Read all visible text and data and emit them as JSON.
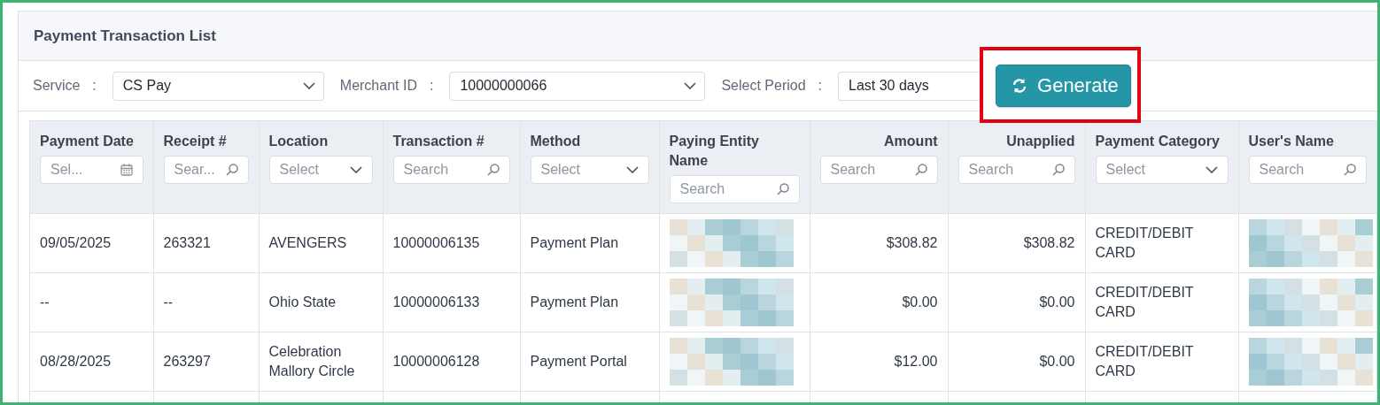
{
  "panel": {
    "title": "Payment Transaction List"
  },
  "filters": [
    {
      "label": "Service",
      "separator": ":",
      "value": "CS Pay",
      "kind": "dropdown"
    },
    {
      "label": "Merchant ID",
      "separator": ":",
      "value": "10000000066",
      "kind": "dropdown"
    },
    {
      "label": "Select Period",
      "separator": ":",
      "value": "Last 30 days",
      "kind": "partial"
    }
  ],
  "generate_button": {
    "label": "Generate",
    "highlighted": true
  },
  "table": {
    "columns": [
      {
        "title": "Payment Date",
        "kind": "text",
        "filter": {
          "kind": "date",
          "placeholder": "Sel..."
        }
      },
      {
        "title": "Receipt #",
        "kind": "text",
        "filter": {
          "kind": "search",
          "placeholder": "Sear..."
        }
      },
      {
        "title": "Location",
        "kind": "text",
        "filter": {
          "kind": "select",
          "placeholder": "Select"
        }
      },
      {
        "title": "Transaction #",
        "kind": "text",
        "filter": {
          "kind": "search",
          "placeholder": "Search"
        }
      },
      {
        "title": "Method",
        "kind": "text",
        "filter": {
          "kind": "select",
          "placeholder": "Select"
        }
      },
      {
        "title": "Paying Entity Name",
        "kind": "text",
        "filter": {
          "kind": "search",
          "placeholder": "Search"
        }
      },
      {
        "title": "Amount",
        "kind": "money",
        "filter": {
          "kind": "search",
          "placeholder": "Search"
        }
      },
      {
        "title": "Unapplied",
        "kind": "money",
        "filter": {
          "kind": "search",
          "placeholder": "Search"
        }
      },
      {
        "title": "Payment Category",
        "kind": "text",
        "filter": {
          "kind": "select",
          "placeholder": "Select"
        }
      },
      {
        "title": "User's Name",
        "kind": "text",
        "filter": {
          "kind": "search",
          "placeholder": "Search"
        }
      }
    ],
    "rows": [
      {
        "cells": [
          {
            "kind": "text",
            "text": "09/05/2025"
          },
          {
            "kind": "text",
            "text": "263321"
          },
          {
            "kind": "text",
            "text": "AVENGERS"
          },
          {
            "kind": "text",
            "text": "10000006135"
          },
          {
            "kind": "text",
            "text": "Payment Plan"
          },
          {
            "kind": "redacted"
          },
          {
            "kind": "text",
            "text": "$308.82"
          },
          {
            "kind": "text",
            "text": "$308.82"
          },
          {
            "kind": "text",
            "text": "CREDIT/DEBIT CARD"
          },
          {
            "kind": "redacted"
          }
        ]
      },
      {
        "cells": [
          {
            "kind": "text",
            "text": "--"
          },
          {
            "kind": "text",
            "text": "--"
          },
          {
            "kind": "text",
            "text": "Ohio State"
          },
          {
            "kind": "text",
            "text": "10000006133"
          },
          {
            "kind": "text",
            "text": "Payment Plan"
          },
          {
            "kind": "redacted"
          },
          {
            "kind": "text",
            "text": "$0.00"
          },
          {
            "kind": "text",
            "text": "$0.00"
          },
          {
            "kind": "text",
            "text": "CREDIT/DEBIT CARD"
          },
          {
            "kind": "redacted"
          }
        ]
      },
      {
        "cells": [
          {
            "kind": "text",
            "text": "08/28/2025"
          },
          {
            "kind": "text",
            "text": "263297"
          },
          {
            "kind": "text",
            "text": "Celebration Mallory Circle"
          },
          {
            "kind": "text",
            "text": "10000006128"
          },
          {
            "kind": "text",
            "text": "Payment Portal"
          },
          {
            "kind": "redacted"
          },
          {
            "kind": "text",
            "text": "$12.00"
          },
          {
            "kind": "text",
            "text": "$0.00"
          },
          {
            "kind": "text",
            "text": "CREDIT/DEBIT CARD"
          },
          {
            "kind": "redacted"
          }
        ]
      }
    ]
  }
}
